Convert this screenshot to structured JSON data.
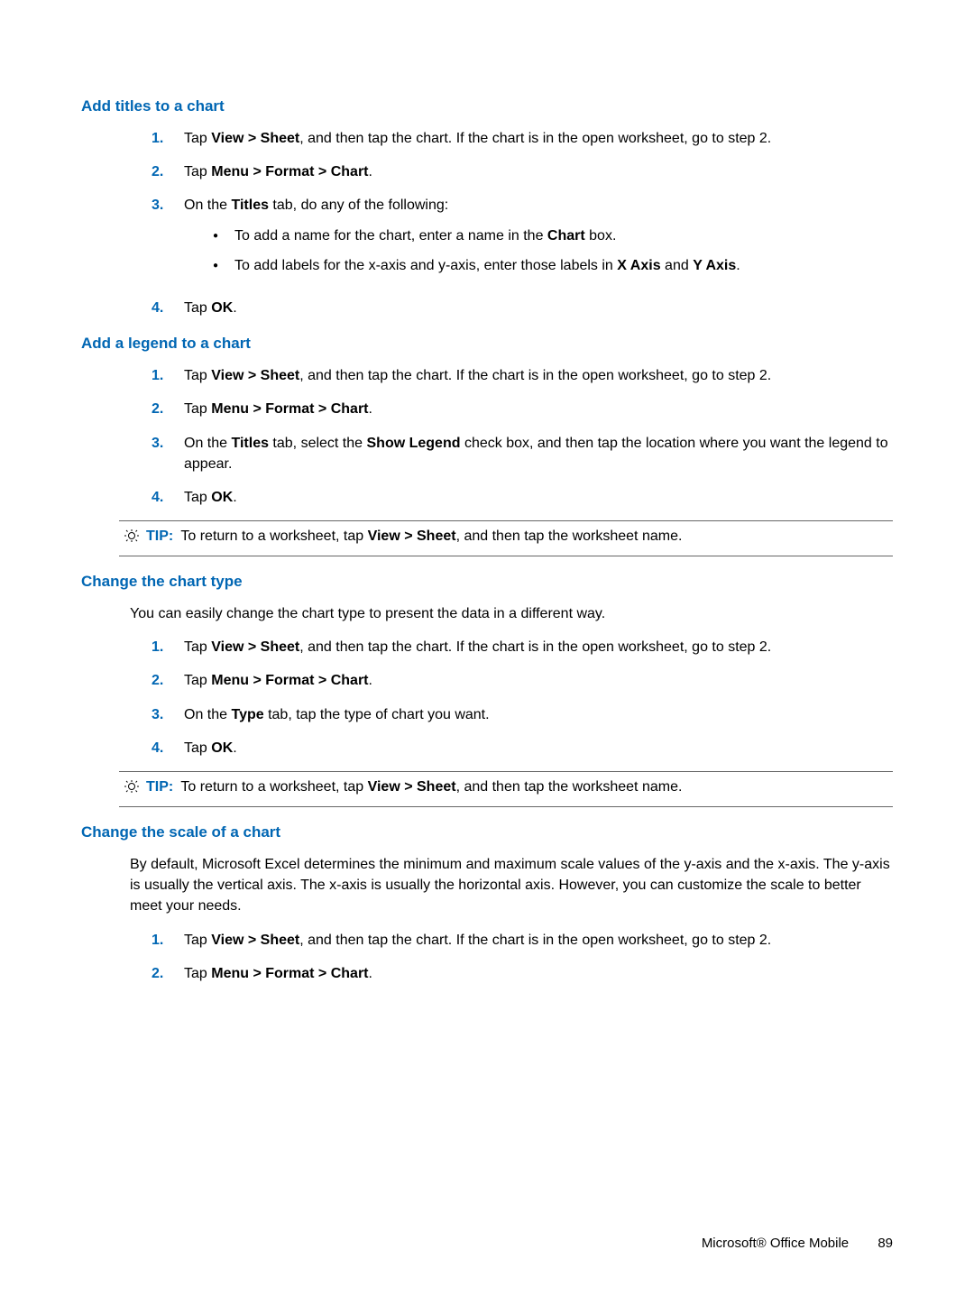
{
  "sections": {
    "add_titles": {
      "heading": "Add titles to a chart",
      "step1_pre": "Tap ",
      "step1_b": "View > Sheet",
      "step1_post": ", and then tap the chart. If the chart is in the open worksheet, go to step 2.",
      "step2_pre": "Tap ",
      "step2_b": "Menu > Format > Chart",
      "step2_post": ".",
      "step3_pre": "On the ",
      "step3_b": "Titles",
      "step3_post": " tab, do any of the following:",
      "bullet1_pre": "To add a name for the chart, enter a name in the ",
      "bullet1_b": "Chart",
      "bullet1_post": " box.",
      "bullet2_pre": "To add labels for the x-axis and y-axis, enter those labels in ",
      "bullet2_b1": "X Axis",
      "bullet2_mid": " and ",
      "bullet2_b2": "Y Axis",
      "bullet2_post": ".",
      "step4_pre": "Tap ",
      "step4_b": "OK",
      "step4_post": "."
    },
    "add_legend": {
      "heading": "Add a legend to a chart",
      "step1_pre": "Tap ",
      "step1_b": "View > Sheet",
      "step1_post": ", and then tap the chart. If the chart is in the open worksheet, go to step 2.",
      "step2_pre": "Tap ",
      "step2_b": "Menu > Format > Chart",
      "step2_post": ".",
      "step3_pre": "On the ",
      "step3_b1": "Titles",
      "step3_mid": " tab, select the ",
      "step3_b2": "Show Legend",
      "step3_post": " check box, and then tap the location where you want the legend to appear.",
      "step4_pre": "Tap ",
      "step4_b": "OK",
      "step4_post": ".",
      "tip_label": "TIP:",
      "tip_pre": "To return to a worksheet, tap ",
      "tip_b": "View > Sheet",
      "tip_post": ", and then tap the worksheet name."
    },
    "change_type": {
      "heading": "Change the chart type",
      "intro": "You can easily change the chart type to present the data in a different way.",
      "step1_pre": "Tap ",
      "step1_b": "View > Sheet",
      "step1_post": ", and then tap the chart. If the chart is in the open worksheet, go to step 2.",
      "step2_pre": "Tap ",
      "step2_b": "Menu > Format > Chart",
      "step2_post": ".",
      "step3_pre": "On the ",
      "step3_b": "Type",
      "step3_post": " tab, tap the type of chart you want.",
      "step4_pre": "Tap ",
      "step4_b": "OK",
      "step4_post": ".",
      "tip_label": "TIP:",
      "tip_pre": "To return to a worksheet, tap ",
      "tip_b": "View > Sheet",
      "tip_post": ", and then tap the worksheet name."
    },
    "change_scale": {
      "heading": "Change the scale of a chart",
      "intro": "By default, Microsoft Excel determines the minimum and maximum scale values of the y-axis and the x-axis. The y-axis is usually the vertical axis. The x-axis is usually the horizontal axis. However, you can customize the scale to better meet your needs.",
      "step1_pre": "Tap ",
      "step1_b": "View > Sheet",
      "step1_post": ", and then tap the chart. If the chart is in the open worksheet, go to step 2.",
      "step2_pre": "Tap ",
      "step2_b": "Menu > Format > Chart",
      "step2_post": "."
    }
  },
  "nums": {
    "one": "1.",
    "two": "2.",
    "three": "3.",
    "four": "4."
  },
  "footer": {
    "title": "Microsoft® Office Mobile",
    "page": "89"
  }
}
